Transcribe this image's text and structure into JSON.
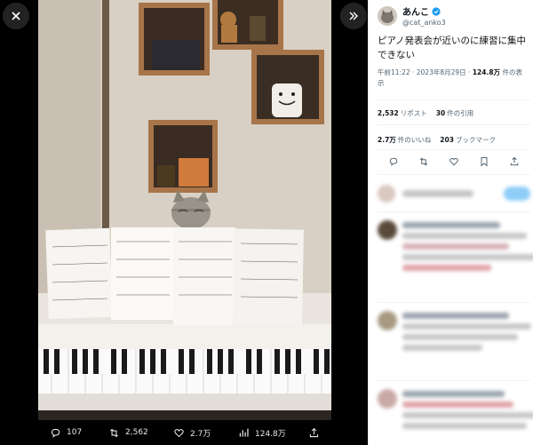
{
  "viewer": {
    "close_icon": "close-icon",
    "expand_icon": "chevrons-right-icon",
    "actions": {
      "replies": "107",
      "reposts": "2,562",
      "likes": "2.7万",
      "views": "124.8万"
    }
  },
  "author": {
    "name": "あんこ",
    "handle": "@cat_anko3",
    "verified": true
  },
  "tweet": {
    "text": "ピアノ発表会が近いのに練習に集中できない",
    "time": "午前11:22 · 2023年8月29日 · ",
    "views_count": "124.8万",
    "views_label": " 件の表示"
  },
  "stats": {
    "reposts_count": "2,532",
    "reposts_label": "リポスト",
    "quotes_count": "30",
    "quotes_label": "件の引用",
    "likes_count": "2.7万",
    "likes_label": "件のいいね",
    "bookmarks_count": "203",
    "bookmarks_label": "ブックマーク"
  },
  "colors": {
    "accent": "#1d9bf0",
    "like_red": "#f91880"
  }
}
